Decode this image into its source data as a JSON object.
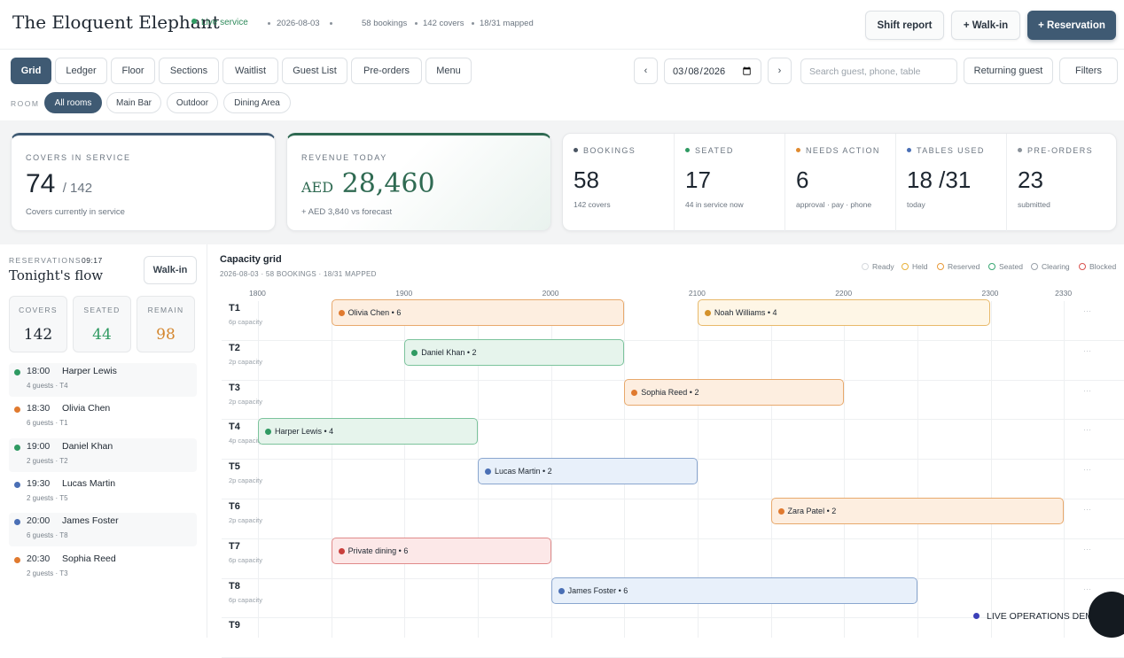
{
  "header": {
    "brand": "The Eloquent Elephant",
    "live": "Live service",
    "date": "2026-08-03",
    "bookings": "58 bookings",
    "covers": "142 covers",
    "mapped": "18/31 mapped",
    "shift_report": "Shift report",
    "walk_in": "+ Walk-in",
    "reservation": "+ Reservation"
  },
  "nav": {
    "tabs": [
      "Grid",
      "Ledger",
      "Floor",
      "Sections",
      "Waitlist",
      "Guest List",
      "Pre-orders",
      "Menu"
    ],
    "prev": "‹",
    "next": "›",
    "date_value": "2026-03-08",
    "search_placeholder": "Search guest, phone, table",
    "returning_guest": "Returning guest",
    "filters": "Filters"
  },
  "rooms": {
    "label": "ROOM",
    "chips": [
      "All rooms",
      "Main Bar",
      "Outdoor",
      "Dining Area"
    ]
  },
  "kpis": {
    "covers": {
      "label": "COVERS IN SERVICE",
      "value": "74",
      "total": "/ 142",
      "sub": "Covers currently in service"
    },
    "revenue": {
      "label": "REVENUE TODAY",
      "currency": "AED",
      "value": "28,460",
      "sub": "+ AED 3,840 vs forecast"
    },
    "stats": [
      {
        "label": "BOOKINGS",
        "value": "58",
        "sub": "142 covers",
        "color": "#4a5563"
      },
      {
        "label": "SEATED",
        "value": "17",
        "sub": "44 in service now",
        "color": "#2f9a62"
      },
      {
        "label": "NEEDS ACTION",
        "value": "6",
        "sub": "approval · pay · phone",
        "color": "#e08a2f"
      },
      {
        "label": "TABLES USED",
        "value": "18 /31",
        "sub": "today",
        "color": "#4a6fb5"
      },
      {
        "label": "PRE-ORDERS",
        "value": "23",
        "sub": "submitted",
        "color": "#8a929a"
      }
    ]
  },
  "sidebar": {
    "eyebrow": "RESERVATIONS",
    "time": "09:17",
    "title": "Tonight's flow",
    "walkin": "Walk-in",
    "minis": [
      {
        "label": "COVERS",
        "value": "142",
        "color": "#1d2630"
      },
      {
        "label": "SEATED",
        "value": "44",
        "color": "#2f9a62"
      },
      {
        "label": "REMAIN",
        "value": "98",
        "color": "#d4862e"
      }
    ],
    "reservations": [
      {
        "time": "18:00",
        "name": "Harper Lewis",
        "sub": "4 guests · T4",
        "color": "#2f9a62"
      },
      {
        "time": "18:30",
        "name": "Olivia Chen",
        "sub": "6 guests · T1",
        "color": "#e07a2f"
      },
      {
        "time": "19:00",
        "name": "Daniel Khan",
        "sub": "2 guests · T2",
        "color": "#2f9a62"
      },
      {
        "time": "19:30",
        "name": "Lucas Martin",
        "sub": "2 guests · T5",
        "color": "#4a6fb5"
      },
      {
        "time": "20:00",
        "name": "James Foster",
        "sub": "6 guests · T8",
        "color": "#4a6fb5"
      },
      {
        "time": "20:30",
        "name": "Sophia Reed",
        "sub": "2 guests · T3",
        "color": "#e07a2f"
      }
    ]
  },
  "grid": {
    "title": "Capacity grid",
    "subtitle": "2026-08-03 · 58 BOOKINGS · 18/31 MAPPED",
    "legend": [
      {
        "label": "Ready",
        "color": "#d5d9dd"
      },
      {
        "label": "Held",
        "color": "#e8b13a"
      },
      {
        "label": "Reserved",
        "color": "#e89a3a"
      },
      {
        "label": "Seated",
        "color": "#3aa874"
      },
      {
        "label": "Clearing",
        "color": "#9aa2aa"
      },
      {
        "label": "Blocked",
        "color": "#d9534f"
      }
    ],
    "hours": [
      "1800",
      "1900",
      "2000",
      "2100",
      "2200",
      "2300",
      "2330"
    ],
    "tables": [
      {
        "name": "T1",
        "cap": "6p capacity"
      },
      {
        "name": "T2",
        "cap": "2p capacity"
      },
      {
        "name": "T3",
        "cap": "2p capacity"
      },
      {
        "name": "T4",
        "cap": "4p capacity"
      },
      {
        "name": "T5",
        "cap": "2p capacity"
      },
      {
        "name": "T6",
        "cap": "2p capacity"
      },
      {
        "name": "T7",
        "cap": "6p capacity"
      },
      {
        "name": "T8",
        "cap": "6p capacity"
      },
      {
        "name": "T9",
        "cap": ""
      }
    ],
    "blocks": [
      {
        "row": 0,
        "start": "18:30",
        "end": "20:30",
        "label": "Olivia Chen • 6",
        "status": "reserved"
      },
      {
        "row": 0,
        "start": "21:00",
        "end": "23:00",
        "label": "Noah Williams • 4",
        "status": "held"
      },
      {
        "row": 1,
        "start": "19:00",
        "end": "20:30",
        "label": "Daniel Khan • 2",
        "status": "seated"
      },
      {
        "row": 2,
        "start": "20:30",
        "end": "22:00",
        "label": "Sophia Reed • 2",
        "status": "reserved"
      },
      {
        "row": 3,
        "start": "18:00",
        "end": "19:30",
        "label": "Harper Lewis • 4",
        "status": "seated"
      },
      {
        "row": 4,
        "start": "19:30",
        "end": "21:00",
        "label": "Lucas Martin • 2",
        "status": "confirmed"
      },
      {
        "row": 5,
        "start": "21:30",
        "end": "23:30",
        "label": "Zara Patel • 2",
        "status": "reserved"
      },
      {
        "row": 6,
        "start": "18:30",
        "end": "20:00",
        "label": "Private dining • 6",
        "status": "blocked"
      },
      {
        "row": 7,
        "start": "20:00",
        "end": "22:30",
        "label": "James Foster • 6",
        "status": "confirmed"
      }
    ],
    "trail": "···"
  },
  "footer": {
    "demo": "LIVE OPERATIONS DEMO"
  }
}
